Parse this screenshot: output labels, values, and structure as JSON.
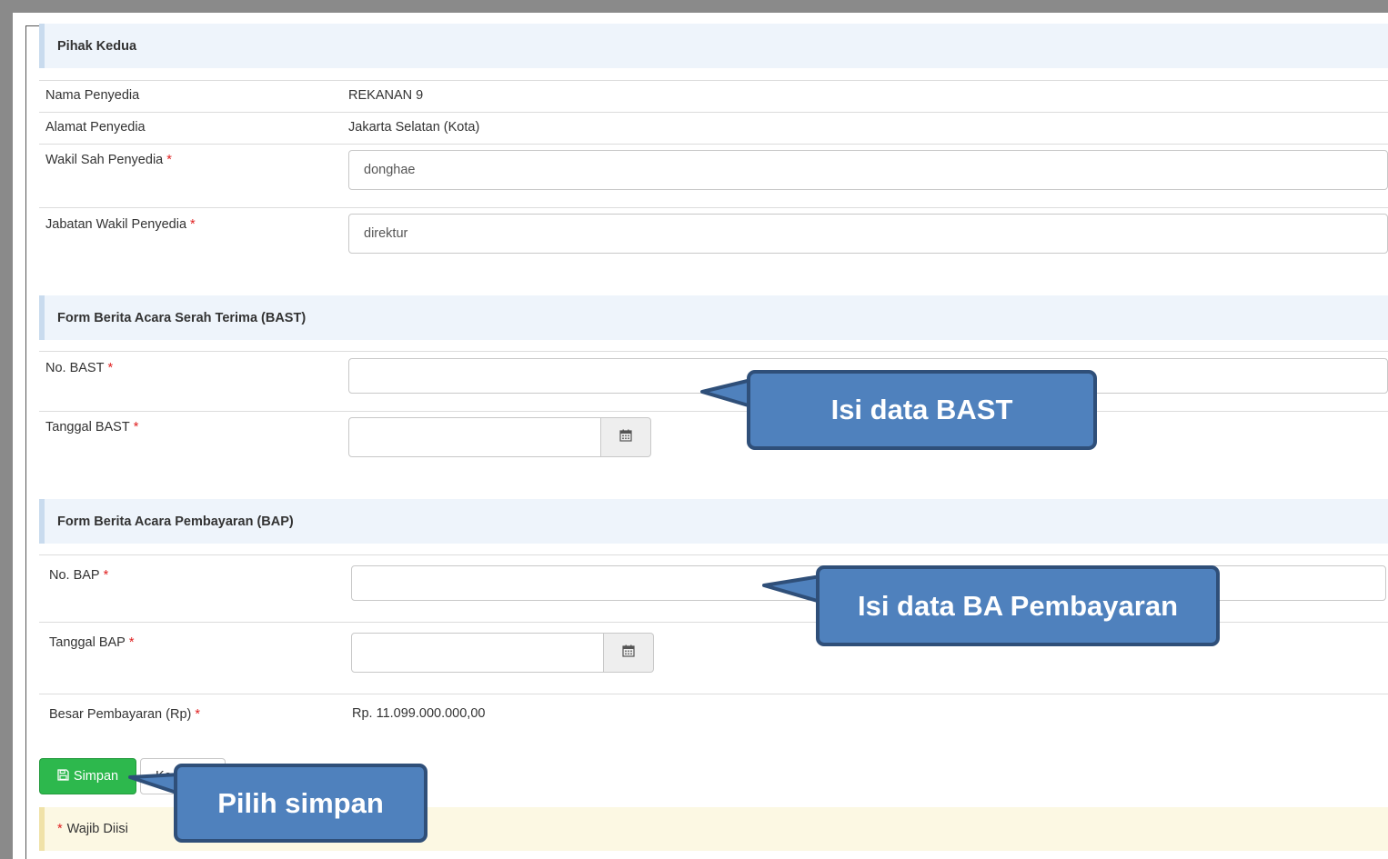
{
  "pihak_kedua": {
    "header": "Pihak Kedua",
    "nama_label": "Nama Penyedia",
    "nama_value": "REKANAN 9",
    "alamat_label": "Alamat Penyedia",
    "alamat_value": "Jakarta Selatan (Kota)",
    "wakil_label": "Wakil Sah Penyedia",
    "wakil_value": "donghae",
    "jabatan_label": "Jabatan Wakil Penyedia",
    "jabatan_value": "direktur"
  },
  "bast": {
    "header": "Form Berita Acara Serah Terima (BAST)",
    "no_label": "No. BAST",
    "no_value": "",
    "tanggal_label": "Tanggal BAST",
    "tanggal_value": ""
  },
  "bap": {
    "header": "Form Berita Acara Pembayaran (BAP)",
    "no_label": "No. BAP",
    "no_value": "",
    "tanggal_label": "Tanggal BAP",
    "tanggal_value": "",
    "besar_label": "Besar Pembayaran (Rp)",
    "besar_value": "Rp. 11.099.000.000,00"
  },
  "required_marker": "*",
  "actions": {
    "save_label": "Simpan",
    "back_label": "Ke"
  },
  "note": {
    "marker": "*",
    "text": "Wajib Diisi"
  },
  "callouts": {
    "bast": "Isi data BAST",
    "bap": "Isi data BA Pembayaran",
    "save": "Pilih simpan"
  },
  "icons": {
    "calendar": "calendar-icon",
    "save": "floppy-disk-icon"
  },
  "colors": {
    "save_button": "#2db84d",
    "callout_fill": "#4f81bd",
    "callout_border": "#2f4f79",
    "required": "#e02020",
    "section_header_bg": "#eef4fb",
    "note_bg": "#fcf8e3"
  }
}
